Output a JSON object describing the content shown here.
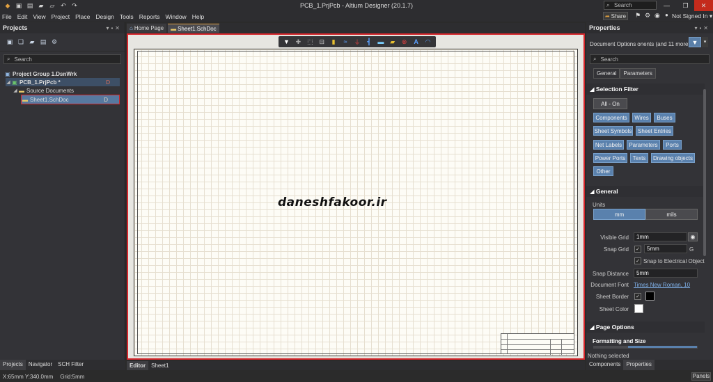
{
  "window": {
    "title": "PCB_1.PrjPcb - Altium Designer (20.1.7)",
    "search_placeholder": "Search"
  },
  "menu": [
    "File",
    "Edit",
    "View",
    "Project",
    "Place",
    "Design",
    "Tools",
    "Reports",
    "Window",
    "Help"
  ],
  "topright": {
    "share": "Share",
    "signin": "Not Signed In"
  },
  "projects_panel": {
    "title": "Projects",
    "search_placeholder": "Search",
    "tree": [
      {
        "label": "Project Group 1.DsnWrk",
        "level": 0,
        "bold": true
      },
      {
        "label": "PCB_1.PrjPcb *",
        "level": 1,
        "bold": true,
        "badge": "D"
      },
      {
        "label": "Source Documents",
        "level": 2
      },
      {
        "label": "Sheet1.SchDoc",
        "level": 3,
        "badge": "D",
        "selected": true
      }
    ],
    "bottom_tabs": [
      "Projects",
      "Navigator",
      "SCH Filter"
    ]
  },
  "doc_tabs": [
    "Home Page",
    "Sheet1.SchDoc"
  ],
  "editor": {
    "watermark": "daneshfakoor.ir",
    "bottom_tabs": [
      "Editor",
      "Sheet1"
    ]
  },
  "properties": {
    "title": "Properties",
    "doc_options": "Document Options",
    "doc_options_extra": "onents (and 11 more)",
    "search_placeholder": "Search",
    "tabs": [
      "General",
      "Parameters"
    ],
    "selection_filter": {
      "title": "Selection Filter",
      "all": "All - On",
      "buttons": [
        "Components",
        "Wires",
        "Buses",
        "Sheet Symbols",
        "Sheet Entries",
        "Net Labels",
        "Parameters",
        "Ports",
        "Power Ports",
        "Texts",
        "Drawing objects",
        "Other"
      ]
    },
    "general": {
      "title": "General",
      "units_label": "Units",
      "unit_mm": "mm",
      "unit_mils": "mils",
      "visible_grid_label": "Visible Grid",
      "visible_grid": "1mm",
      "snap_grid_label": "Snap Grid",
      "snap_grid": "5mm",
      "snap_grid_key": "G",
      "snap_electrical": "Snap to Electrical Object",
      "snap_distance_label": "Snap Distance",
      "snap_distance": "5mm",
      "doc_font_label": "Document Font",
      "doc_font": "Times New Roman, 10",
      "sheet_border_label": "Sheet Border",
      "sheet_color_label": "Sheet Color"
    },
    "page_options": {
      "title": "Page Options",
      "formatting": "Formatting and Size"
    },
    "status": "Nothing selected",
    "bottom_tabs": [
      "Components",
      "Properties"
    ]
  },
  "statusbar": {
    "coords": "X:65mm Y:340.0mm",
    "grid": "Grid:5mm",
    "panels": "Panels"
  }
}
